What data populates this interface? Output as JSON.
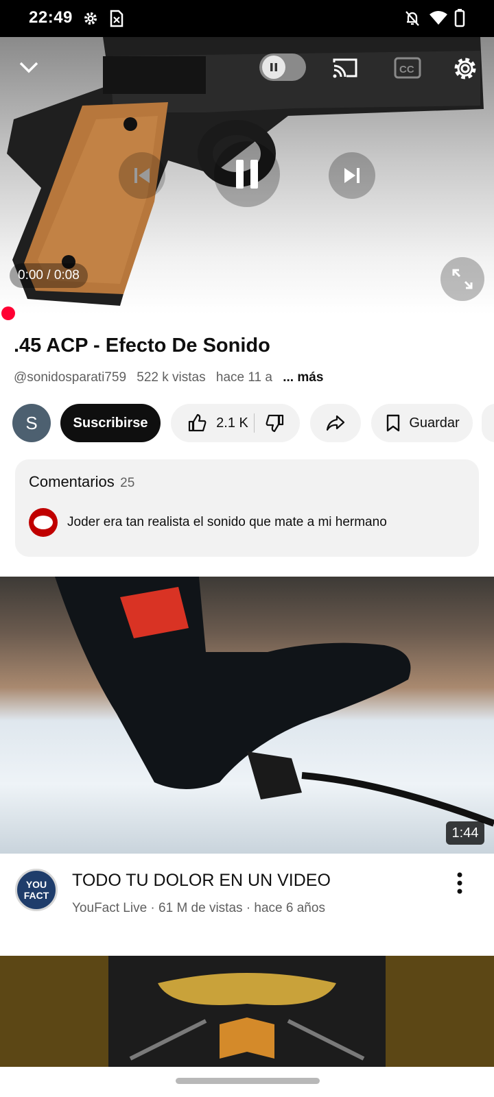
{
  "status_bar": {
    "time": "22:49",
    "icons": [
      "gear-icon",
      "sim-x-icon",
      "bell-off-icon",
      "wifi-icon",
      "battery-icon"
    ]
  },
  "player": {
    "time_display": "0:00 / 0:08",
    "autoplay_state": "paused",
    "progress_fraction": 0.0,
    "icons": [
      "chevron-down-icon",
      "autoplay-toggle-icon",
      "cast-icon",
      "cc-icon",
      "settings-icon",
      "previous-icon",
      "pause-icon",
      "next-icon",
      "fullscreen-icon"
    ]
  },
  "video": {
    "title": ".45 ACP - Efecto De Sonido",
    "channel_handle": "@sonidosparati759",
    "views": "522 k vistas",
    "age": "hace 11 a",
    "more": "... más"
  },
  "actions": {
    "avatar_letter": "S",
    "subscribe_label": "Suscribirse",
    "like_count": "2.1 K",
    "save_label": "Guardar"
  },
  "comments": {
    "title": "Comentarios",
    "count": "25",
    "top_comment": "Joder era tan realista el sonido que mate a mi hermano"
  },
  "recommendations": [
    {
      "duration": "1:44",
      "channel_logo_text": "YOU FACT",
      "title": "TODO TU DOLOR EN UN VIDEO",
      "meta": "YouFact Live · 61 M de vistas · hace 6 años"
    }
  ],
  "colors": {
    "accent_red": "#ff0033",
    "subscribe_bg": "#0f0f0f",
    "pill_bg": "#f2f2f2",
    "meta_text": "#606060"
  }
}
